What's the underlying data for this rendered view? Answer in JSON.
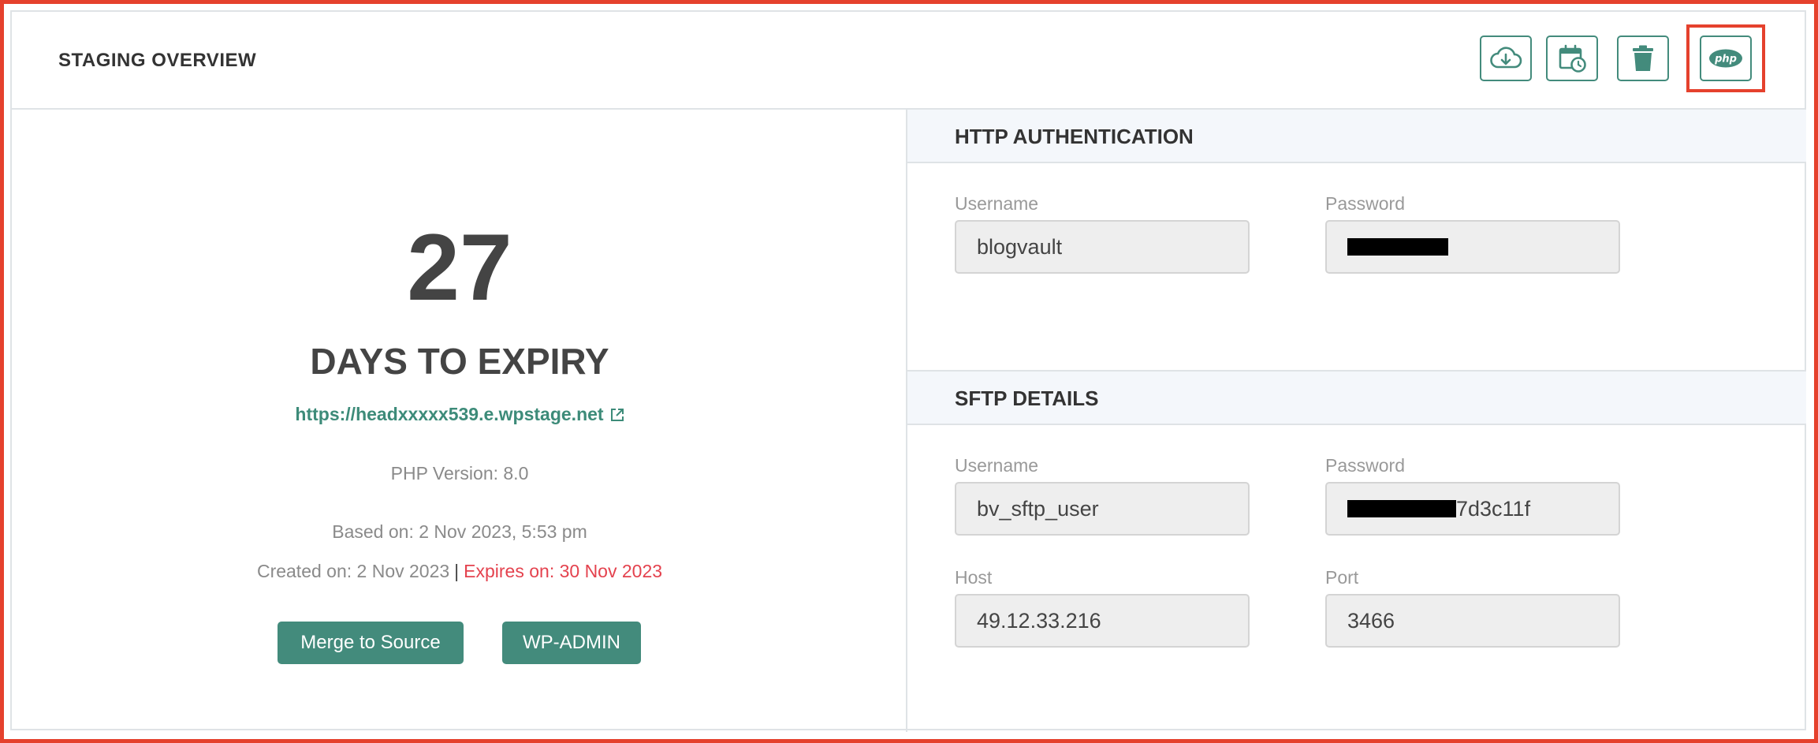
{
  "header": {
    "title": "STAGING OVERVIEW",
    "icons": [
      "cloud-download-icon",
      "calendar-clock-icon",
      "trash-icon",
      "php-icon"
    ]
  },
  "overview": {
    "days": "27",
    "days_label": "DAYS TO EXPIRY",
    "url": "https://headxxxxx539.e.wpstage.net",
    "php_version": "PHP Version: 8.0",
    "based_on": "Based on: 2 Nov 2023, 5:53 pm",
    "created_on": "Created on: 2 Nov 2023",
    "separator": "|",
    "expires_on": "Expires on: 30 Nov 2023",
    "merge_button": "Merge to Source",
    "wpadmin_button": "WP-ADMIN"
  },
  "http_auth": {
    "title": "HTTP AUTHENTICATION",
    "username_label": "Username",
    "username": "blogvault",
    "password_label": "Password"
  },
  "sftp": {
    "title": "SFTP DETAILS",
    "username_label": "Username",
    "username": "bv_sftp_user",
    "password_label": "Password",
    "password_visible_suffix": "7d3c11f",
    "host_label": "Host",
    "host": "49.12.33.216",
    "port_label": "Port",
    "port": "3466"
  },
  "colors": {
    "accent": "#438b7c",
    "link": "#3d8b79",
    "danger": "#e4424e",
    "highlight": "#e5412d"
  }
}
